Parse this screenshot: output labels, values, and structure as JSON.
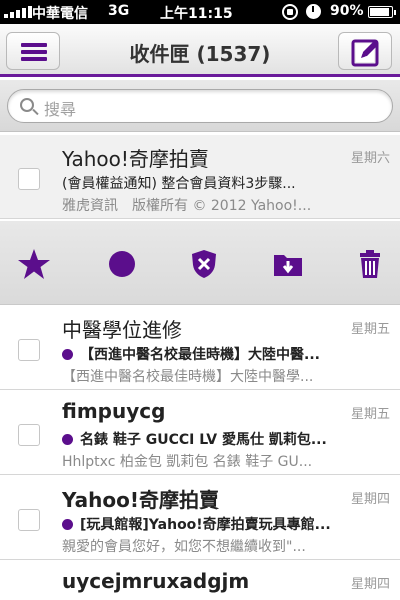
{
  "status_bar": {
    "carrier": "中華電信",
    "network": "3G",
    "time": "上午11:15",
    "battery": "90%",
    "battery_level": 0.9
  },
  "navbar": {
    "menu_icon": "hamburger-menu-icon",
    "title": "收件匣 (1537)",
    "compose_icon": "compose-edit-icon"
  },
  "search": {
    "placeholder": "搜尋",
    "icon": "search-icon"
  },
  "colors": {
    "accent": "#5b0e8c",
    "nav_underline": "#6a1a9a"
  },
  "action_bar": {
    "icons": [
      "star-icon",
      "circle-unread-icon",
      "shield-spam-icon",
      "move-to-folder-icon",
      "trash-icon"
    ]
  },
  "messages": [
    {
      "sender": "Yahoo!奇摩拍賣",
      "subject": "(會員權益通知) 整合會員資料3步驟...",
      "preview": "雅虎資訊　版權所有 © 2012 Yahoo!...",
      "date": "星期六",
      "unread": false,
      "selected": true
    },
    {
      "sender": "中醫學位進修",
      "subject": "【西進中醫名校最佳時機】大陸中醫...",
      "preview": "【西進中醫名校最佳時機】大陸中醫學...",
      "date": "星期五",
      "unread": true,
      "selected": false
    },
    {
      "sender": "fimpuycg",
      "subject": "名錶 鞋子 GUCCI LV 愛馬仕 凱莉包...",
      "preview": "Hhlptxc 柏金包 凱莉包 名錶 鞋子 GU...",
      "date": "星期五",
      "unread": true,
      "selected": false
    },
    {
      "sender": "Yahoo!奇摩拍賣",
      "subject": "[玩具館報]Yahoo!奇摩拍賣玩具專館...",
      "preview": "親愛的會員您好，如您不想繼續收到\"...",
      "date": "星期四",
      "unread": true,
      "selected": false
    },
    {
      "sender": "uycejmruxadgjm",
      "date": "星期四",
      "unread": true,
      "selected": false
    }
  ]
}
